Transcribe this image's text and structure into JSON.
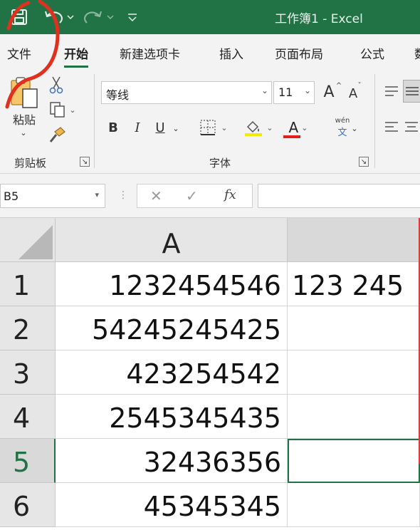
{
  "window": {
    "title": "工作簿1  -  Excel"
  },
  "quick_access": {
    "save_icon": "save-icon",
    "undo_icon": "undo-icon",
    "redo_icon": "redo-icon",
    "customize_icon": "customize-qat-icon"
  },
  "tabs": [
    {
      "label": "文件"
    },
    {
      "label": "开始"
    },
    {
      "label": "新建选项卡"
    },
    {
      "label": "插入"
    },
    {
      "label": "页面布局"
    },
    {
      "label": "公式"
    },
    {
      "label": "数"
    }
  ],
  "ribbon": {
    "clipboard": {
      "paste_label": "粘贴",
      "group_label": "剪贴板"
    },
    "font": {
      "font_name": "等线",
      "font_size": "11",
      "grow_label": "A",
      "shrink_label": "A",
      "bold": "B",
      "italic": "I",
      "underline": "U",
      "font_color_label": "A",
      "phonetic_top": "wén",
      "phonetic_bottom": "文",
      "group_label": "字体"
    },
    "colors": {
      "accent": "#217346",
      "font_color_bar": "#e02020",
      "annotation": "#e0301e"
    }
  },
  "formula_bar": {
    "name_box": "B5",
    "cancel": "✕",
    "enter": "✓",
    "fx": "fx",
    "formula": ""
  },
  "sheet": {
    "columns": [
      "A",
      ""
    ],
    "rows": [
      {
        "num": "1",
        "a": "1232454546",
        "b": "123 245"
      },
      {
        "num": "2",
        "a": "54245245425",
        "b": ""
      },
      {
        "num": "3",
        "a": "423254542",
        "b": ""
      },
      {
        "num": "4",
        "a": "2545345435",
        "b": ""
      },
      {
        "num": "5",
        "a": "32436356",
        "b": ""
      },
      {
        "num": "6",
        "a": "45345345",
        "b": ""
      }
    ],
    "active_cell": "B5"
  }
}
